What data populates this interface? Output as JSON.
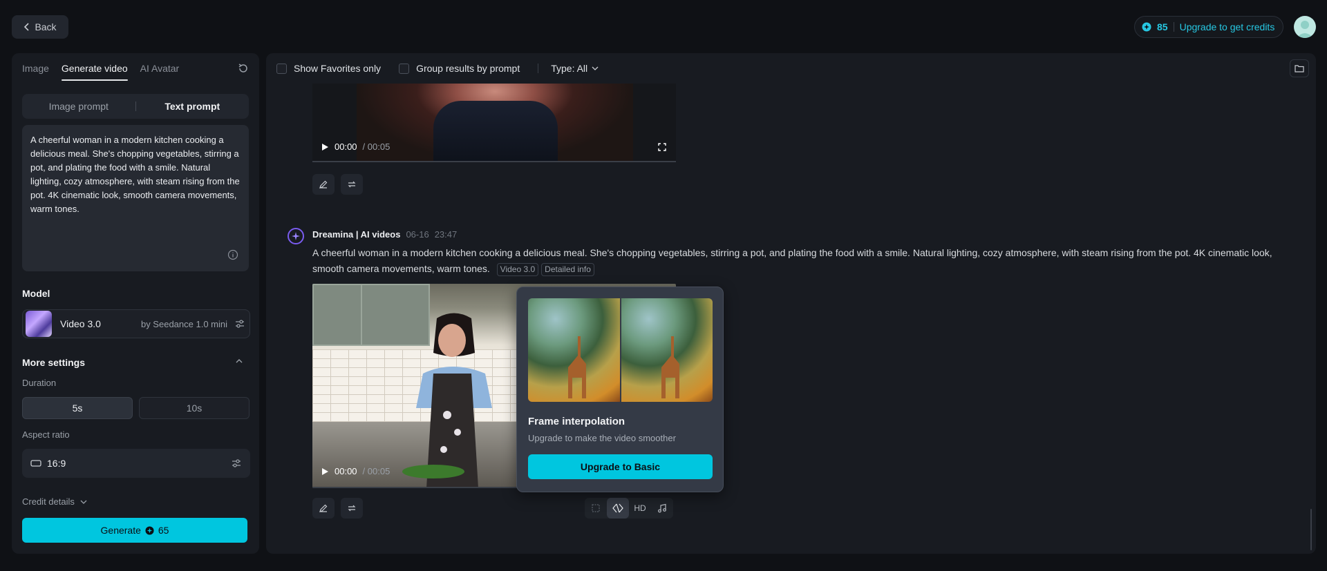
{
  "header": {
    "back_label": "Back",
    "credits": "85",
    "upgrade_label": "Upgrade to get credits"
  },
  "left": {
    "tabs": [
      "Image",
      "Generate video",
      "AI Avatar"
    ],
    "prompt_modes": [
      "Image prompt",
      "Text prompt"
    ],
    "prompt_text": "A cheerful woman in a modern kitchen cooking a delicious meal. She's chopping vegetables, stirring a pot, and plating the food with a smile. Natural lighting, cozy atmosphere, with steam rising from the pot. 4K cinematic look, smooth camera movements, warm tones.",
    "model_title": "Model",
    "model_name": "Video 3.0",
    "model_by": "by Seedance 1.0 mini",
    "more_settings": "More settings",
    "duration_label": "Duration",
    "durations": [
      "5s",
      "10s"
    ],
    "aspect_label": "Aspect ratio",
    "aspect_value": "16:9",
    "credit_details": "Credit details",
    "generate_label": "Generate",
    "generate_cost": "65"
  },
  "main": {
    "filters": {
      "favorites": "Show Favorites only",
      "group": "Group results by prompt",
      "type": "Type: All"
    },
    "video1": {
      "time": "00:00",
      "duration": "/ 00:05"
    },
    "entry": {
      "author": "Dreamina | AI videos",
      "date": "06-16",
      "time": "23:47",
      "text": "A cheerful woman in a modern kitchen cooking a delicious meal. She's chopping vegetables, stirring a pot, and plating the food with a smile. Natural lighting, cozy atmosphere, with steam rising from the pot. 4K cinematic look, smooth camera movements, warm tones.",
      "tag_model": "Video 3.0",
      "tag_info": "Detailed info"
    },
    "video2": {
      "time": "00:00",
      "duration": "/ 00:05"
    },
    "popup": {
      "title": "Frame interpolation",
      "subtitle": "Upgrade to make the video smoother",
      "button": "Upgrade to Basic"
    },
    "tools": {
      "hd": "HD"
    }
  },
  "colors": {
    "accent": "#00c6df",
    "bot": "#7a5cf0"
  }
}
